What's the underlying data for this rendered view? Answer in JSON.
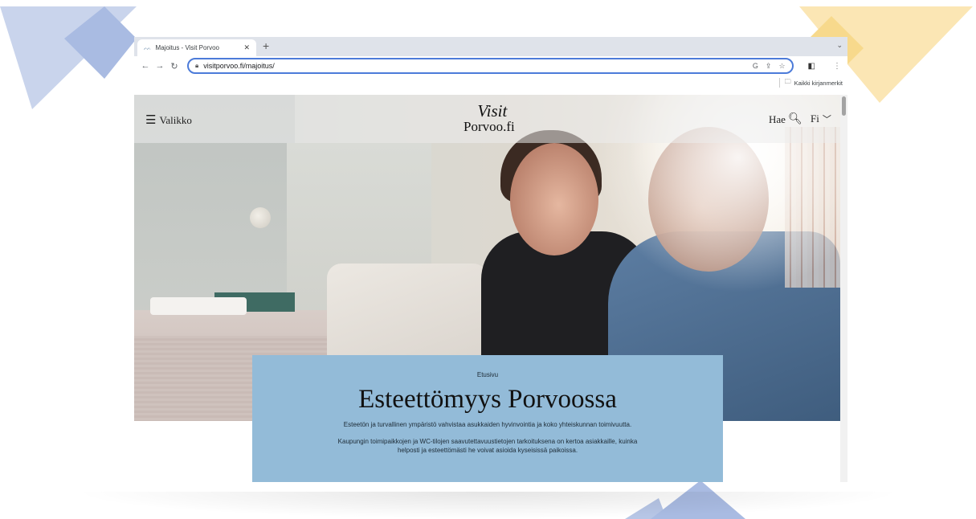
{
  "browser": {
    "tab_title": "Majoitus - Visit Porvoo",
    "tab_favicon": "visitporvoo-favicon",
    "new_tab": "+",
    "url": "visitporvoo.fi/majoitus/",
    "bookmarks_label": "Kaikki kirjanmerkit"
  },
  "site": {
    "menu_label": "Valikko",
    "logo_line1": "Visit",
    "logo_line2": "Porvoo.fi",
    "search_label": "Hae",
    "lang_label": "Fi"
  },
  "hero": {
    "breadcrumb": "Etusivu",
    "title": "Esteettömyys Porvoossa",
    "paragraph1": "Esteetön ja turvallinen ympäristö vahvistaa asukkaiden hyvinvointia ja koko yhteiskunnan toimivuutta.",
    "paragraph2": "Kaupungin toimipaikkojen ja WC-tilojen saavutettavuustietojen tarkoituksena on kertoa asiakkaille, kuinka helposti ja esteettömästi he voivat asioida kyseisissä paikoissa."
  },
  "colors": {
    "card": "#93bbd8",
    "deco_blue": "#8fa8d6",
    "deco_yellow": "#f7d98c",
    "omnibox_border": "#4c7bd9"
  }
}
